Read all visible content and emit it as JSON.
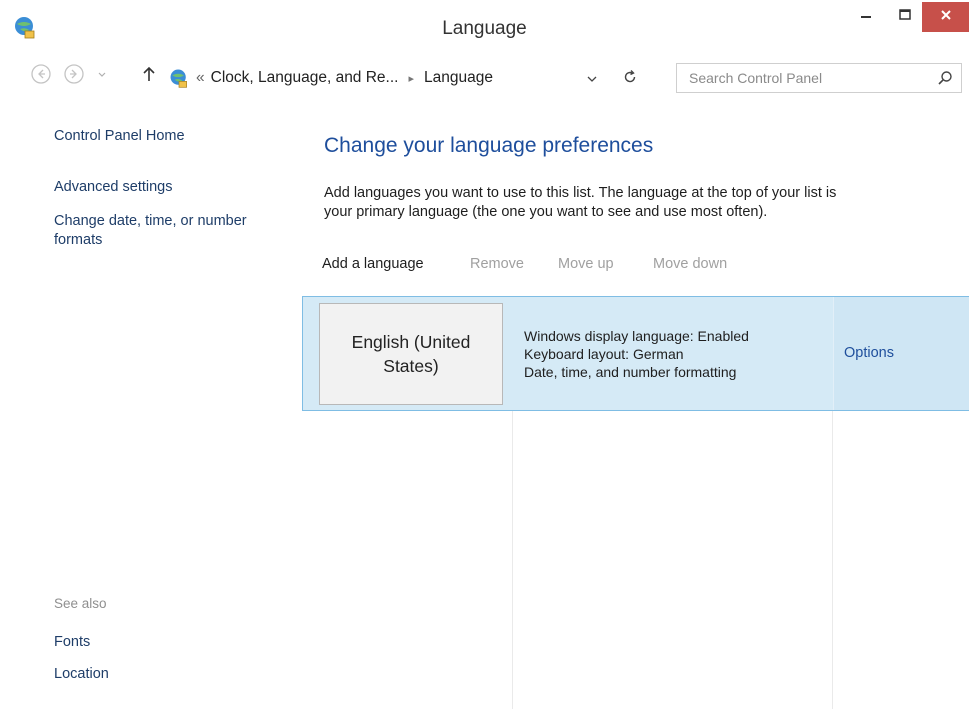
{
  "window": {
    "title": "Language",
    "controls": {
      "minimize": "minimize-icon",
      "maximize": "maximize-icon",
      "close": "close-icon"
    },
    "close_color": "#c7504a"
  },
  "nav": {
    "breadcrumb": {
      "overflow": "«",
      "items": [
        "Clock, Language, and Re...",
        "Language"
      ],
      "separator": "▸"
    },
    "search": {
      "placeholder": "Search Control Panel"
    }
  },
  "sidebar": {
    "home": "Control Panel Home",
    "links": [
      "Advanced settings",
      "Change date, time, or number",
      "formats"
    ],
    "see_also_label": "See also",
    "see_also_links": [
      "Fonts",
      "Location"
    ]
  },
  "main": {
    "heading": "Change your language preferences",
    "description_line1": "Add languages you want to use to this list. The language at the top of your list is",
    "description_line2": "your primary language (the one you want to see and use most often).",
    "toolbar": {
      "add": "Add a language",
      "remove": "Remove",
      "move_up": "Move up",
      "move_down": "Move down"
    },
    "languages": [
      {
        "name_line1": "English (United",
        "name_line2": "States)",
        "details": [
          "Windows display language: Enabled",
          "Keyboard layout: German",
          "Date, time, and number formatting"
        ],
        "options_label": "Options"
      }
    ]
  },
  "colors": {
    "link": "#1e3d68",
    "heading": "#1e4e9c",
    "selected_row": "#d5eaf6",
    "selected_border": "#7fbde4"
  }
}
